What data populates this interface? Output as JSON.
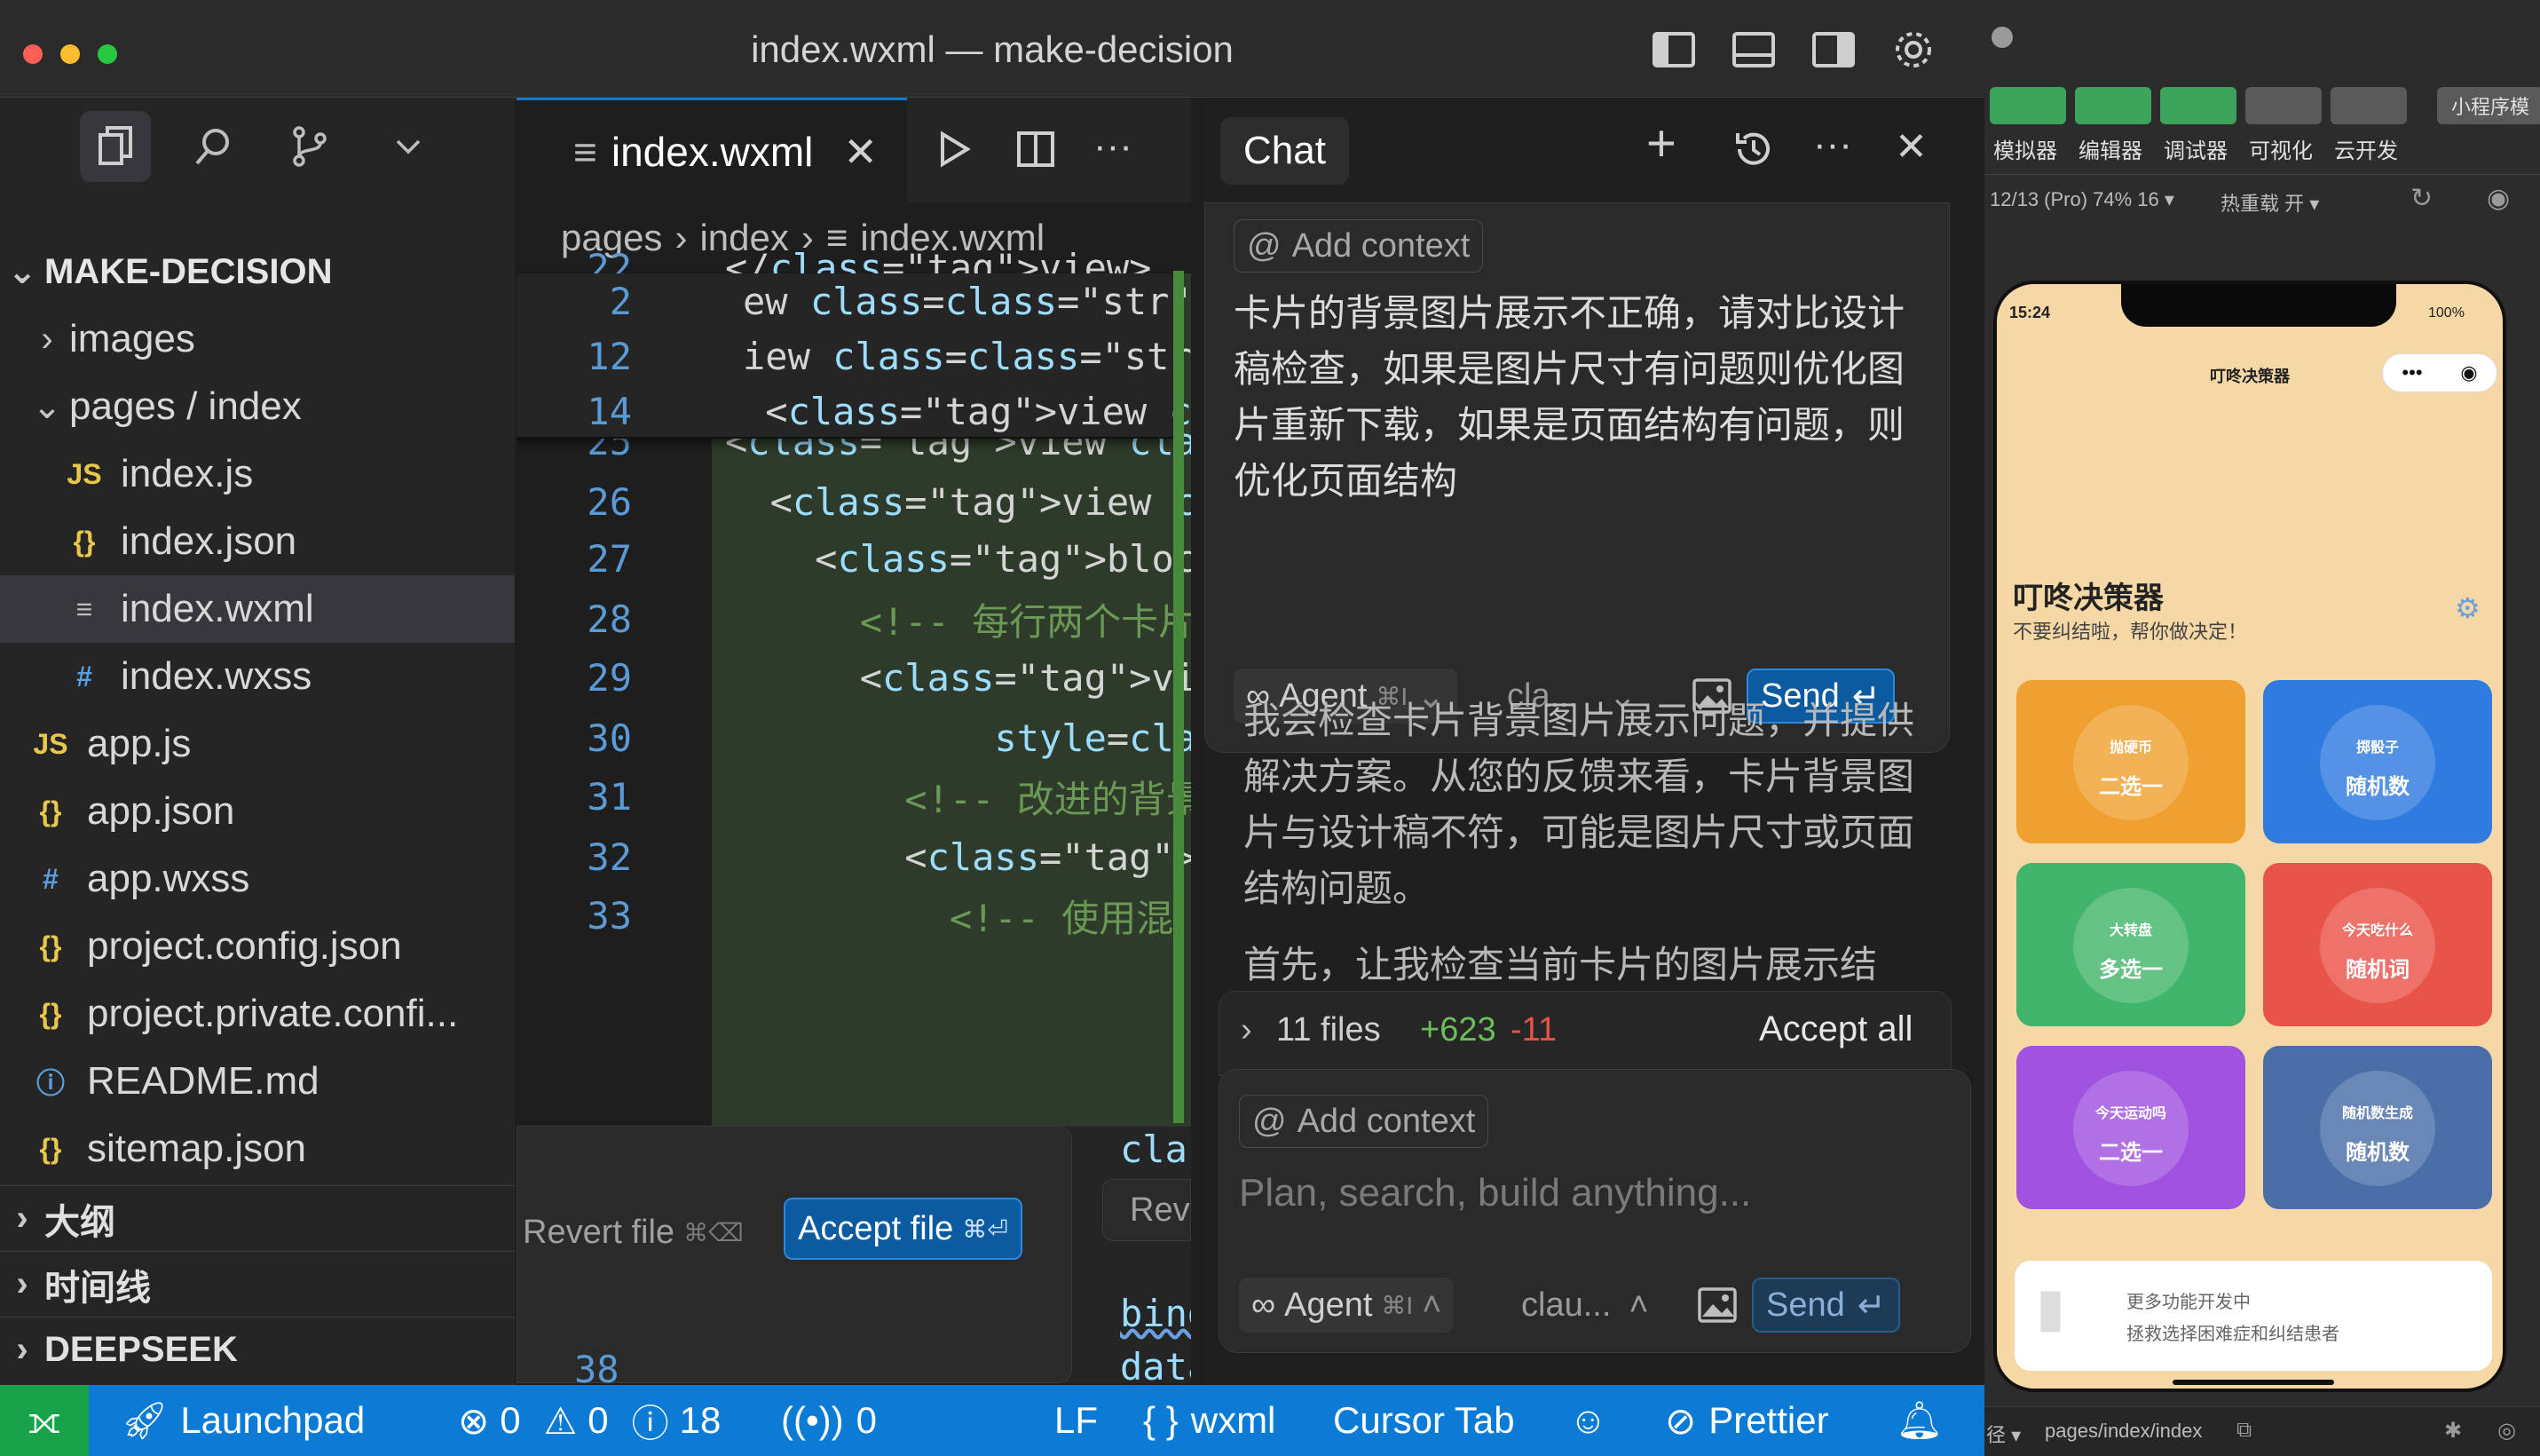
{
  "window": {
    "title": "index.wxml — make-decision"
  },
  "sidebar": {
    "project": "MAKE-DECISION",
    "tree": [
      {
        "label": "images",
        "icon": "chevron-right",
        "depth": 1
      },
      {
        "label": "pages / index",
        "icon": "chevron-down",
        "depth": 1
      },
      {
        "label": "index.js",
        "icon": "JS",
        "depth": 2
      },
      {
        "label": "index.json",
        "icon": "{}",
        "depth": 2
      },
      {
        "label": "index.wxml",
        "icon": "≡",
        "depth": 2
      },
      {
        "label": "index.wxss",
        "icon": "#",
        "depth": 2
      },
      {
        "label": "app.js",
        "icon": "JS",
        "depth": 1
      },
      {
        "label": "app.json",
        "icon": "{}",
        "depth": 1
      },
      {
        "label": "app.wxss",
        "icon": "#",
        "depth": 1
      },
      {
        "label": "project.config.json",
        "icon": "{}",
        "depth": 1
      },
      {
        "label": "project.private.confi...",
        "icon": "{}",
        "depth": 1
      },
      {
        "label": "README.md",
        "icon": "ⓘ",
        "depth": 1
      },
      {
        "label": "sitemap.json",
        "icon": "{}",
        "depth": 1
      }
    ],
    "sections": [
      "大纲",
      "时间线",
      "DEEPSEEK"
    ]
  },
  "editor": {
    "tab": "index.wxml",
    "breadcrumbs": [
      "pages",
      "index",
      "index.wxml"
    ],
    "sticky": [
      {
        "n": "2",
        "code": "ew class=\"container\" i"
      },
      {
        "n": "12",
        "code": "iew class=\"main-con e"
      },
      {
        "n": "14",
        "code": " <view class=\"header"
      }
    ],
    "lines": [
      {
        "n": "22",
        "code": "</view>"
      },
      {
        "n": "23",
        "code": ""
      },
      {
        "n": "24",
        "code": "<!-- 卡片列表 -->"
      },
      {
        "n": "25",
        "code": "<view class=\"card-co"
      },
      {
        "n": "26",
        "code": "  <view class=\"card-"
      },
      {
        "n": "27",
        "code": "    <block wx:for=\"{"
      },
      {
        "n": "28",
        "code": "      <!-- 每行两个卡片"
      },
      {
        "n": "29",
        "code": "      <view class=\"c"
      },
      {
        "n": "30",
        "code": "            style=\"b"
      },
      {
        "n": "31",
        "code": "        <!-- 改进的背景"
      },
      {
        "n": "32",
        "code": "        <view class="
      },
      {
        "n": "33",
        "code": "          <!-- 使用混"
      },
      {
        "n": "38",
        "code": ""
      }
    ],
    "overflow_code": [
      "clas",
      "bind",
      "data"
    ],
    "revert_label": "Revert file",
    "revert_shortcut": "⌘⌫",
    "accept_label": "Accept file",
    "accept_shortcut": "⌘⏎",
    "rev_label": "Rev"
  },
  "chat": {
    "tab": "Chat",
    "add_context": "Add context",
    "user_message": "卡片的背景图片展示不正确，请对比设计稿检查，如果是图片尺寸有问题则优化图片重新下载，如果是页面结构有问题，则优化页面结构",
    "agent_label": "Agent",
    "agent_shortcut": "⌘I",
    "model_short": "cla...",
    "model_short2": "clau...",
    "send_label": "Send",
    "response_p1": "我会检查卡片背景图片展示问题，并提供解决方案。从您的反馈来看，卡片背景图片与设计稿不符，可能是图片尺寸或页面结构问题。",
    "response_p2": "首先，让我检查当前卡片的图片展示结",
    "files_summary": "11 files",
    "additions": "+623",
    "deletions": "-11",
    "accept_all": "Accept all",
    "input_placeholder": "Plan, search, build anything..."
  },
  "statusbar": {
    "launchpad": "Launchpad",
    "errors": "0",
    "warnings": "0",
    "infos": "18",
    "ports": "0",
    "eol": "LF",
    "language": "wxml",
    "cursor_tab": "Cursor Tab",
    "prettier": "Prettier"
  },
  "devtools": {
    "buttons": [
      "模拟器",
      "编辑器",
      "调试器",
      "可视化",
      "云开发"
    ],
    "miniprogram_label": "小程序模",
    "device": "12/13 (Pro) 74% 16 ▾",
    "hot_reload": "热重载 开 ▾",
    "path": "pages/index/index",
    "path_prefix": "径 ▾"
  },
  "phone": {
    "time": "15:24",
    "battery": "100%",
    "nav_title": "叮咚决策器",
    "app_title": "叮咚决策器",
    "subtitle": "不要纠结啦，帮你做决定！",
    "cards": [
      {
        "small": "抛硬币",
        "label": "二选一",
        "color": "#f0a030"
      },
      {
        "small": "掷骰子",
        "label": "随机数",
        "color": "#2f7be0"
      },
      {
        "small": "大转盘",
        "label": "多选一",
        "color": "#41b56a"
      },
      {
        "small": "今天吃什么",
        "label": "随机词",
        "color": "#e8534a"
      },
      {
        "small": "今天运动吗",
        "label": "二选一",
        "color": "#a052e0"
      },
      {
        "small": "随机数生成",
        "label": "随机数",
        "color": "#4a6ea8"
      }
    ],
    "banner_title": "更多功能开发中",
    "banner_sub": "拯救选择困难症和纠结患者"
  }
}
